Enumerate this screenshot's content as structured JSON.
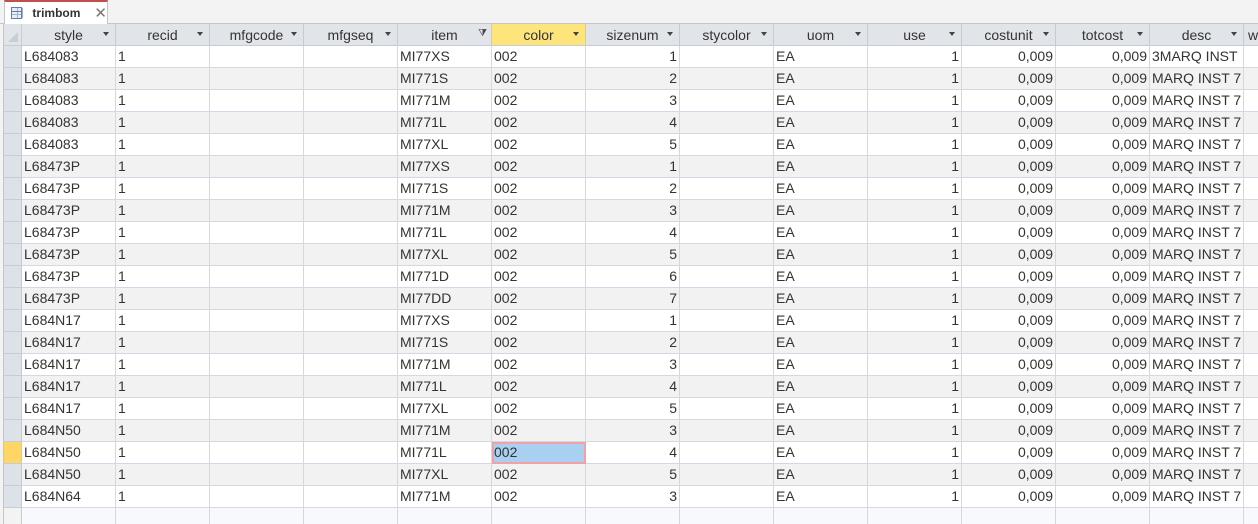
{
  "tab": {
    "title": "trimbom",
    "icon": "table-icon",
    "close_icon": "close-icon"
  },
  "columns": [
    {
      "key": "style",
      "label": "style",
      "align": "left"
    },
    {
      "key": "recid",
      "label": "recid",
      "align": "left"
    },
    {
      "key": "mfgcode",
      "label": "mfgcode",
      "align": "left"
    },
    {
      "key": "mfgseq",
      "label": "mfgseq",
      "align": "left"
    },
    {
      "key": "item",
      "label": "item",
      "align": "left",
      "filtered": true
    },
    {
      "key": "color",
      "label": "color",
      "align": "left",
      "selected": true
    },
    {
      "key": "sizenum",
      "label": "sizenum",
      "align": "right"
    },
    {
      "key": "stycolor",
      "label": "stycolor",
      "align": "left"
    },
    {
      "key": "uom",
      "label": "uom",
      "align": "left"
    },
    {
      "key": "use",
      "label": "use",
      "align": "right"
    },
    {
      "key": "costunit",
      "label": "costunit",
      "align": "right"
    },
    {
      "key": "totcost",
      "label": "totcost",
      "align": "right"
    },
    {
      "key": "desc",
      "label": "desc",
      "align": "left"
    },
    {
      "key": "w",
      "label": "w",
      "align": "left",
      "partial": true
    }
  ],
  "current_row_index": 18,
  "focused_cell": {
    "row": 18,
    "column": "color"
  },
  "rows": [
    [
      "L684083",
      "1",
      "",
      "",
      "MI77XS",
      "002",
      "1",
      "",
      "EA",
      "1",
      "0,009",
      "0,009",
      "3MARQ INST",
      ""
    ],
    [
      "L684083",
      "1",
      "",
      "",
      "MI771S",
      "002",
      "2",
      "",
      "EA",
      "1",
      "0,009",
      "0,009",
      "MARQ INST 7",
      ""
    ],
    [
      "L684083",
      "1",
      "",
      "",
      "MI771M",
      "002",
      "3",
      "",
      "EA",
      "1",
      "0,009",
      "0,009",
      "MARQ INST 7",
      ""
    ],
    [
      "L684083",
      "1",
      "",
      "",
      "MI771L",
      "002",
      "4",
      "",
      "EA",
      "1",
      "0,009",
      "0,009",
      "MARQ INST 7",
      ""
    ],
    [
      "L684083",
      "1",
      "",
      "",
      "MI77XL",
      "002",
      "5",
      "",
      "EA",
      "1",
      "0,009",
      "0,009",
      "MARQ INST 7",
      ""
    ],
    [
      "L68473P",
      "1",
      "",
      "",
      "MI77XS",
      "002",
      "1",
      "",
      "EA",
      "1",
      "0,009",
      "0,009",
      "MARQ INST 7",
      ""
    ],
    [
      "L68473P",
      "1",
      "",
      "",
      "MI771S",
      "002",
      "2",
      "",
      "EA",
      "1",
      "0,009",
      "0,009",
      "MARQ INST 7",
      ""
    ],
    [
      "L68473P",
      "1",
      "",
      "",
      "MI771M",
      "002",
      "3",
      "",
      "EA",
      "1",
      "0,009",
      "0,009",
      "MARQ INST 7",
      ""
    ],
    [
      "L68473P",
      "1",
      "",
      "",
      "MI771L",
      "002",
      "4",
      "",
      "EA",
      "1",
      "0,009",
      "0,009",
      "MARQ INST 7",
      ""
    ],
    [
      "L68473P",
      "1",
      "",
      "",
      "MI77XL",
      "002",
      "5",
      "",
      "EA",
      "1",
      "0,009",
      "0,009",
      "MARQ INST 7",
      ""
    ],
    [
      "L68473P",
      "1",
      "",
      "",
      "MI771D",
      "002",
      "6",
      "",
      "EA",
      "1",
      "0,009",
      "0,009",
      "MARQ INST 7",
      ""
    ],
    [
      "L68473P",
      "1",
      "",
      "",
      "MI77DD",
      "002",
      "7",
      "",
      "EA",
      "1",
      "0,009",
      "0,009",
      "MARQ INST 7",
      ""
    ],
    [
      "L684N17",
      "1",
      "",
      "",
      "MI77XS",
      "002",
      "1",
      "",
      "EA",
      "1",
      "0,009",
      "0,009",
      "MARQ INST 7",
      ""
    ],
    [
      "L684N17",
      "1",
      "",
      "",
      "MI771S",
      "002",
      "2",
      "",
      "EA",
      "1",
      "0,009",
      "0,009",
      "MARQ INST 7",
      ""
    ],
    [
      "L684N17",
      "1",
      "",
      "",
      "MI771M",
      "002",
      "3",
      "",
      "EA",
      "1",
      "0,009",
      "0,009",
      "MARQ INST 7",
      ""
    ],
    [
      "L684N17",
      "1",
      "",
      "",
      "MI771L",
      "002",
      "4",
      "",
      "EA",
      "1",
      "0,009",
      "0,009",
      "MARQ INST 7",
      ""
    ],
    [
      "L684N17",
      "1",
      "",
      "",
      "MI77XL",
      "002",
      "5",
      "",
      "EA",
      "1",
      "0,009",
      "0,009",
      "MARQ INST 7",
      ""
    ],
    [
      "L684N50",
      "1",
      "",
      "",
      "MI771M",
      "002",
      "3",
      "",
      "EA",
      "1",
      "0,009",
      "0,009",
      "MARQ INST 7",
      ""
    ],
    [
      "L684N50",
      "1",
      "",
      "",
      "MI771L",
      "002",
      "4",
      "",
      "EA",
      "1",
      "0,009",
      "0,009",
      "MARQ INST 7",
      ""
    ],
    [
      "L684N50",
      "1",
      "",
      "",
      "MI77XL",
      "002",
      "5",
      "",
      "EA",
      "1",
      "0,009",
      "0,009",
      "MARQ INST 7",
      ""
    ],
    [
      "L684N64",
      "1",
      "",
      "",
      "MI771M",
      "002",
      "3",
      "",
      "EA",
      "1",
      "0,009",
      "0,009",
      "MARQ INST 7",
      ""
    ]
  ]
}
